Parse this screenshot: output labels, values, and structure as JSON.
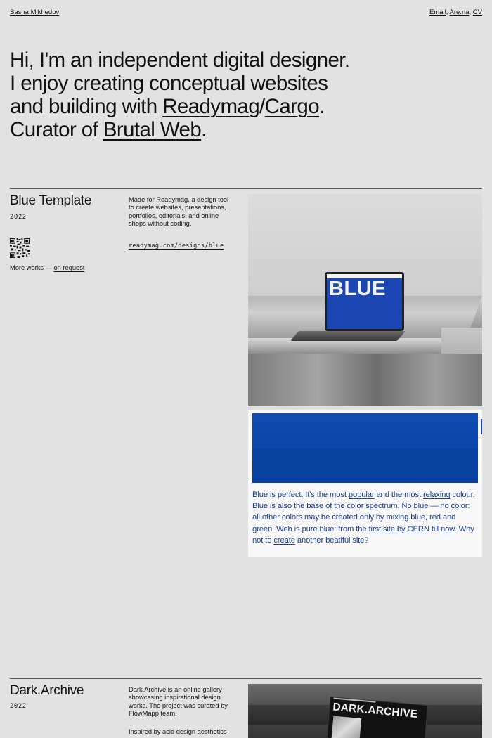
{
  "header": {
    "name": "Sasha Mikhedov",
    "links": [
      "Email",
      "Are.na",
      "CV"
    ],
    "separator": ", "
  },
  "hero": {
    "line1": "Hi, I'm an independent digital designer.",
    "line2": "I enjoy creating conceptual websites",
    "line3_prefix": "and building with ",
    "link_readymag": "Readymag",
    "slash": "/",
    "link_cargo": "Cargo",
    "line3_suffix": ".",
    "line4_prefix": "Curator of ",
    "link_brutal": "Brutal Web",
    "line4_suffix": "."
  },
  "projects": [
    {
      "title": "Blue Template",
      "year": "2022",
      "description": "Made for Readymag, a design tool to create websites, presentations, portfolios, editorials, and online shops without coding.",
      "url": "readymag.com/designs/blue",
      "more_prefix": "More works — ",
      "more_link": "on request",
      "laptop_word": "BLUE",
      "card_text": {
        "p1": "Blue is perfect. It's the most ",
        "l1": "popular",
        "p2": " and the most ",
        "l2": "relaxing",
        "p3": " colour. Blue is also the base of the color spectrum. No blue — no color: all other colors may be created only by mixing blue, red and green. Web is pure blue: from the ",
        "l3": "first site by CERN",
        "p4": " till ",
        "l4": "now",
        "p5": ". Why not to ",
        "l5": "create",
        "p6": " another beatiful site?"
      }
    },
    {
      "title": "Dark.Archive",
      "year": "2022",
      "description": "Dark.Archive is an online gallery showcasing inspirational design works. The project was curated by FlowMapp team.",
      "description2": "Inspired by acid design aesthetics",
      "mag_title": "DARK.ARCHIVE"
    }
  ],
  "colors": {
    "background": "#e2e2e2",
    "blue": "#1d46b5",
    "card_text": "#1a3f95"
  }
}
